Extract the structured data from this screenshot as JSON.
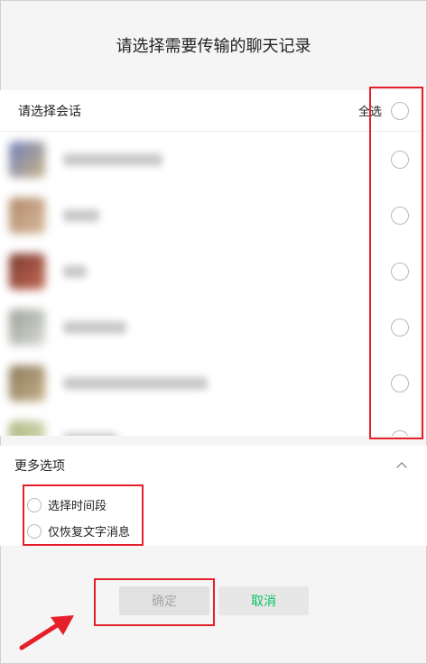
{
  "dialog": {
    "title": "请选择需要传输的聊天记录"
  },
  "list": {
    "header_label": "请选择会话",
    "select_all_label": "全选",
    "conversations": [
      {
        "avatar_colors": [
          "#6f7fb8",
          "#c8b48a"
        ],
        "name_width": 110
      },
      {
        "avatar_colors": [
          "#b08a6a",
          "#d7b89a"
        ],
        "name_width": 40
      },
      {
        "avatar_colors": [
          "#7a3a30",
          "#c46a55"
        ],
        "name_width": 26
      },
      {
        "avatar_colors": [
          "#9aa098",
          "#d8dad4"
        ],
        "name_width": 70
      },
      {
        "avatar_colors": [
          "#8a7a5a",
          "#c7b08a"
        ],
        "name_width": 160
      },
      {
        "avatar_colors": [
          "#a9b27a",
          "#e2e6c8"
        ],
        "name_width": 60
      }
    ]
  },
  "options": {
    "header_label": "更多选项",
    "select_time_range": "选择时间段",
    "text_only": "仅恢复文字消息"
  },
  "buttons": {
    "ok": "确定",
    "cancel": "取消"
  },
  "colors": {
    "accent_green": "#07c160",
    "highlight_red": "#e5202a"
  }
}
